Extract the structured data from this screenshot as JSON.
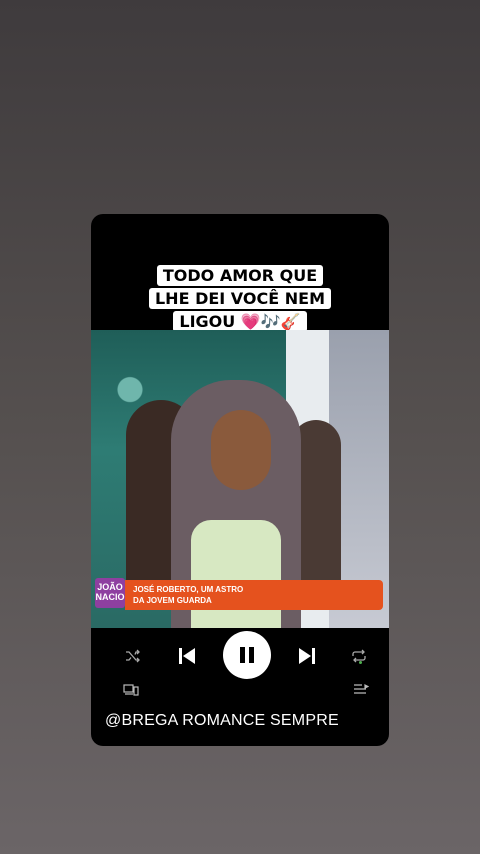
{
  "caption": {
    "line1": "TODO AMOR QUE",
    "line2": "LHE DEI VOCÊ NEM",
    "line3": "LIGOU 💗🎶🎸"
  },
  "video": {
    "channel_logo": "JOÃO NACIO",
    "ticker_line1": "JOSÉ ROBERTO, UM ASTRO",
    "ticker_line2": "DA JOVEM GUARDA"
  },
  "controls": {
    "shuffle_icon": "shuffle-icon",
    "previous_icon": "skip-previous-icon",
    "play_pause_icon": "pause-icon",
    "next_icon": "skip-next-icon",
    "repeat_icon": "repeat-icon",
    "devices_icon": "devices-icon",
    "queue_icon": "queue-icon"
  },
  "footer": {
    "handle": "@BREGA ROMANCE SEMPRE"
  },
  "colors": {
    "card_bg": "#000000",
    "ticker": "#e5521e",
    "logo": "#8e3fa0",
    "repeat_active": "#4fb04f"
  }
}
